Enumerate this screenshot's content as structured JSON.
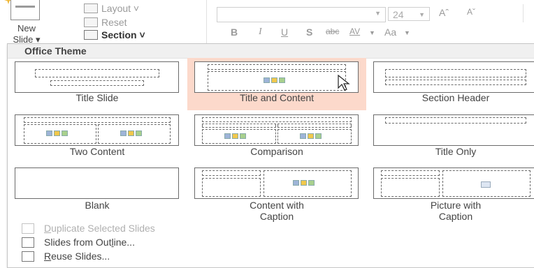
{
  "ribbon": {
    "new_slide_line1": "New",
    "new_slide_line2": "Slide ▾",
    "layout": "Layout ˅",
    "reset": "Reset",
    "section": "Section ˅",
    "font_size": "24",
    "bold": "B",
    "italic": "I",
    "underline": "U",
    "shadow": "S",
    "strikethrough": "abc",
    "char_spacing": "AV",
    "change_case": "Aa",
    "grow_font": "Aˆ",
    "shrink_font": "Aˇ"
  },
  "panel": {
    "section_title": "Office Theme",
    "layouts": [
      {
        "label": "Title Slide"
      },
      {
        "label": "Title and Content",
        "highlighted": true
      },
      {
        "label": "Section Header"
      },
      {
        "label": "Two Content"
      },
      {
        "label": "Comparison"
      },
      {
        "label": "Title Only"
      },
      {
        "label": "Blank"
      },
      {
        "label": "Content with\nCaption"
      },
      {
        "label": "Picture with\nCaption"
      }
    ],
    "menu": [
      {
        "prefix": "",
        "ul": "D",
        "rest": "uplicate Selected Slides",
        "enabled": false
      },
      {
        "prefix": "Slides from Out",
        "ul": "l",
        "rest": "ine...",
        "enabled": true
      },
      {
        "prefix": "",
        "ul": "R",
        "rest": "euse Slides...",
        "enabled": true
      }
    ]
  },
  "colors": {
    "highlight": "#fcd9cb",
    "header_bg": "#f0f0f0",
    "accent": "#d24726"
  }
}
